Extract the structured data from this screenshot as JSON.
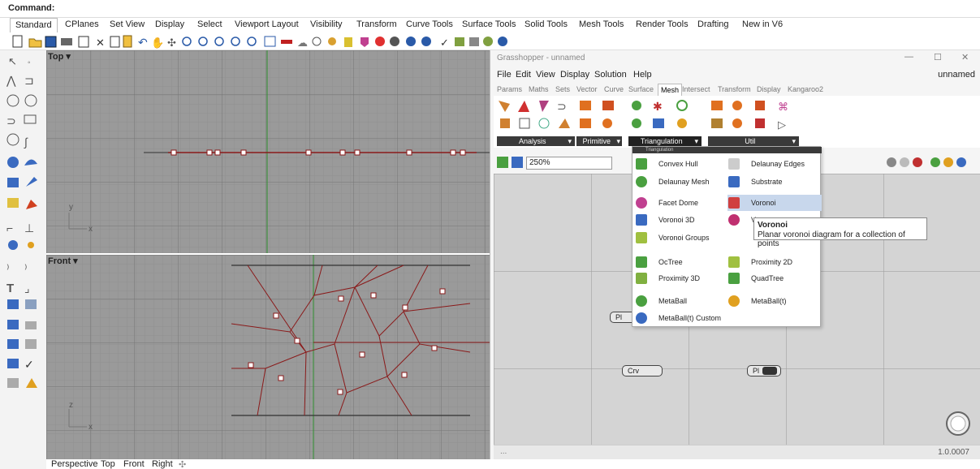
{
  "command_bar": {
    "label": "Command:"
  },
  "tabs": [
    "Standard",
    "CPlanes",
    "Set View",
    "Display",
    "Select",
    "Viewport Layout",
    "Visibility",
    "Transform",
    "Curve Tools",
    "Surface Tools",
    "Solid Tools",
    "Mesh Tools",
    "Render Tools",
    "Drafting",
    "New in V6"
  ],
  "viewports": {
    "top": {
      "label": "Top"
    },
    "front": {
      "label": "Front"
    },
    "axis_y": "y",
    "axis_x": "x",
    "axis_z": "z"
  },
  "bottom_tabs": [
    "Perspective",
    "Top",
    "Front",
    "Right"
  ],
  "grasshopper": {
    "title": "Grasshopper - unnamed",
    "doc_name": "unnamed",
    "menu": [
      "File",
      "Edit",
      "View",
      "Display",
      "Solution",
      "Help"
    ],
    "tabs": [
      "Params",
      "Maths",
      "Sets",
      "Vector",
      "Curve",
      "Surface",
      "Mesh",
      "Intersect",
      "Transform",
      "Display",
      "Kangaroo2"
    ],
    "active_tab": "Mesh",
    "groups": [
      "Analysis",
      "Primitive",
      "Triangulation",
      "Util"
    ],
    "zoom": "250%",
    "status_left": "...",
    "version": "1.0.0007",
    "nodes": {
      "pl1": "Pl",
      "crv": "Crv",
      "pl2": "Pl"
    }
  },
  "dropdown": {
    "header": "Triangulation",
    "items_left": [
      "Convex Hull",
      "Delaunay Mesh",
      "Facet Dome",
      "Voronoi 3D",
      "Voronoi Groups",
      "OcTree",
      "Proximity 3D",
      "MetaBall",
      "MetaBall(t) Custom"
    ],
    "items_right": [
      "Delaunay Edges",
      "Substrate",
      "Voronoi",
      "Voronoi Cell",
      "Proximity 2D",
      "QuadTree",
      "MetaBall(t)"
    ],
    "highlighted": "Voronoi"
  },
  "tooltip": {
    "title": "Voronoi",
    "description": "Planar voronoi diagram for a collection of points"
  },
  "colors": {
    "curve_red": "#8a1a1a",
    "axis_green": "#2f8f2f",
    "grid": "#9a9a9a",
    "dropdown_highlight": "#c8d7ec"
  }
}
